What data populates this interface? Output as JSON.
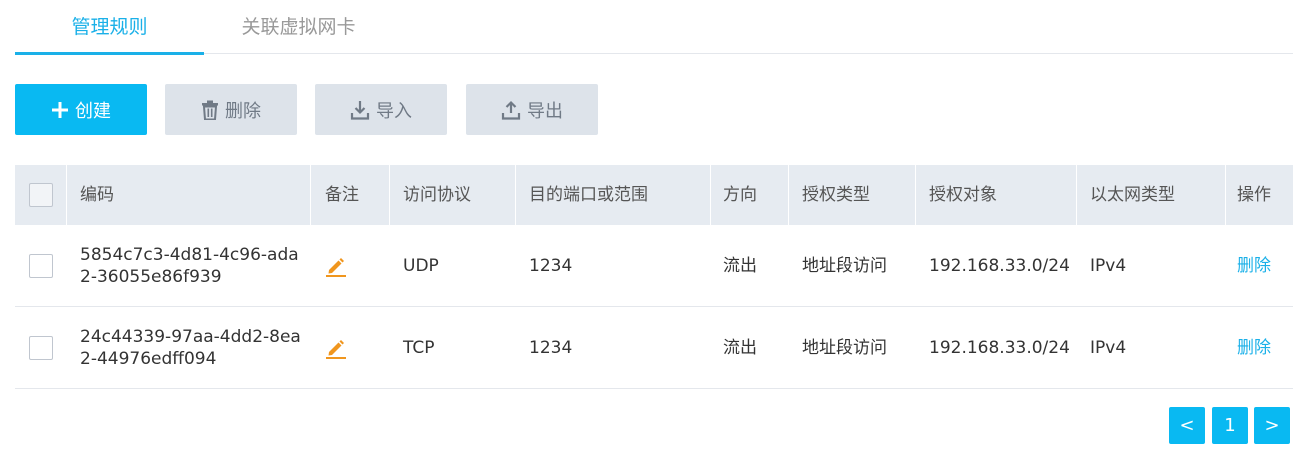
{
  "tabs": [
    {
      "label": "管理规则",
      "active": true
    },
    {
      "label": "关联虚拟网卡",
      "active": false
    }
  ],
  "toolbar": {
    "create_label": "创建",
    "delete_label": "删除",
    "import_label": "导入",
    "export_label": "导出"
  },
  "table": {
    "headers": {
      "code": "编码",
      "note": "备注",
      "protocol": "访问协议",
      "port": "目的端口或范围",
      "direction": "方向",
      "auth_type": "授权类型",
      "auth_target": "授权对象",
      "eth_type": "以太网类型",
      "op": "操作"
    },
    "rows": [
      {
        "code": "5854c7c3-4d81-4c96-ada2-36055e86f939",
        "protocol": "UDP",
        "port": "1234",
        "direction": "流出",
        "auth_type": "地址段访问",
        "auth_target": "192.168.33.0/24",
        "eth_type": "IPv4",
        "op": "删除"
      },
      {
        "code": "24c44339-97aa-4dd2-8ea2-44976edff094",
        "protocol": "TCP",
        "port": "1234",
        "direction": "流出",
        "auth_type": "地址段访问",
        "auth_target": "192.168.33.0/24",
        "eth_type": "IPv4",
        "op": "删除"
      }
    ]
  },
  "pagination": {
    "prev": "<",
    "current": "1",
    "next": ">"
  },
  "colors": {
    "accent": "#09b9f2",
    "link": "#1ab0e8",
    "edit_icon": "#f0961e",
    "header_bg": "#e6ebf1",
    "gray_button": "#dde3ea"
  }
}
